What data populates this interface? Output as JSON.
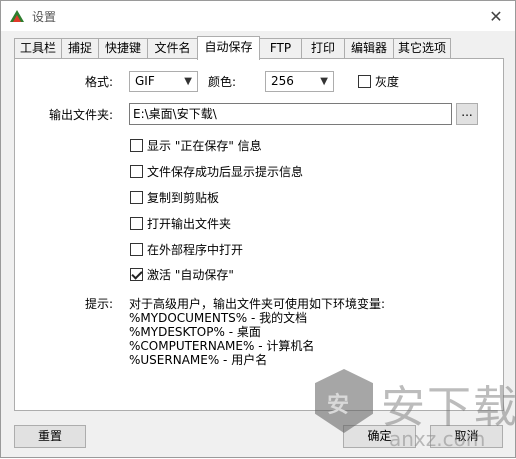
{
  "window": {
    "title": "设置",
    "close_glyph": "✕"
  },
  "tabs": [
    {
      "label": "工具栏",
      "active": false
    },
    {
      "label": "捕捉",
      "active": false
    },
    {
      "label": "快捷键",
      "active": false
    },
    {
      "label": "文件名",
      "active": false
    },
    {
      "label": "自动保存",
      "active": true
    },
    {
      "label": "FTP",
      "active": false
    },
    {
      "label": "打印",
      "active": false
    },
    {
      "label": "编辑器",
      "active": false
    },
    {
      "label": "其它选项",
      "active": false
    }
  ],
  "format": {
    "label": "格式:",
    "value": "GIF"
  },
  "color": {
    "label": "颜色:",
    "value": "256"
  },
  "grayscale": {
    "label": "灰度",
    "checked": false
  },
  "output_folder": {
    "label": "输出文件夹:",
    "value": "E:\\桌面\\安下载\\",
    "browse_label": "..."
  },
  "options": [
    {
      "label": "显示 \"正在保存\" 信息",
      "checked": false
    },
    {
      "label": "文件保存成功后显示提示信息",
      "checked": false
    },
    {
      "label": "复制到剪贴板",
      "checked": false
    },
    {
      "label": "打开输出文件夹",
      "checked": false
    },
    {
      "label": "在外部程序中打开",
      "checked": false
    },
    {
      "label": "激活 \"自动保存\"",
      "checked": true
    }
  ],
  "hint": {
    "label": "提示:",
    "text": "对于高级用户，输出文件夹可使用如下环境变量:",
    "variables": [
      "%MYDOCUMENTS% - 我的文档",
      "%MYDESKTOP% - 桌面",
      "%COMPUTERNAME% - 计算机名",
      "%USERNAME% - 用户名"
    ]
  },
  "buttons": {
    "reset": "重置",
    "ok": "确定",
    "cancel": "取消"
  },
  "watermark": {
    "badge": "安",
    "text": "安下载",
    "sub": "anxz.com"
  }
}
